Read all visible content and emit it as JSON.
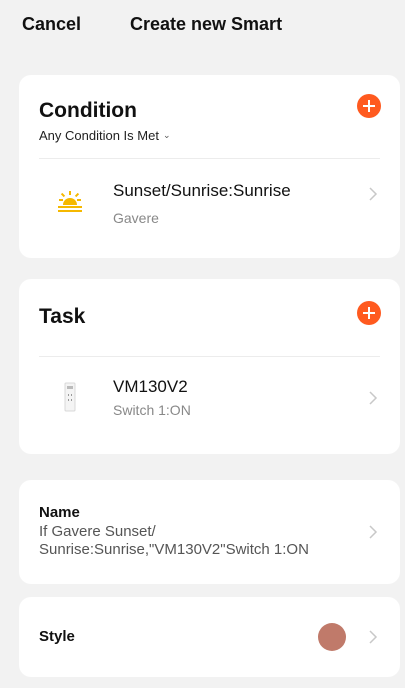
{
  "header": {
    "cancel_label": "Cancel",
    "title": "Create new Smart"
  },
  "condition": {
    "title": "Condition",
    "mode_label": "Any Condition Is Met",
    "items": [
      {
        "main": "Sunset/Sunrise:Sunrise",
        "sub": "Gavere",
        "icon": "sunrise-icon"
      }
    ]
  },
  "task": {
    "title": "Task",
    "items": [
      {
        "main": "VM130V2",
        "sub": "Switch 1:ON",
        "icon": "switch-device-icon"
      }
    ]
  },
  "name": {
    "label": "Name",
    "value": "If Gavere Sunset/ Sunrise:Sunrise,\"VM130V2\"Switch 1:ON"
  },
  "style": {
    "label": "Style",
    "color": "#c07a6a"
  },
  "colors": {
    "accent": "#ff5a1f",
    "sun_icon": "#f5b800",
    "background": "#f2f2f2"
  }
}
